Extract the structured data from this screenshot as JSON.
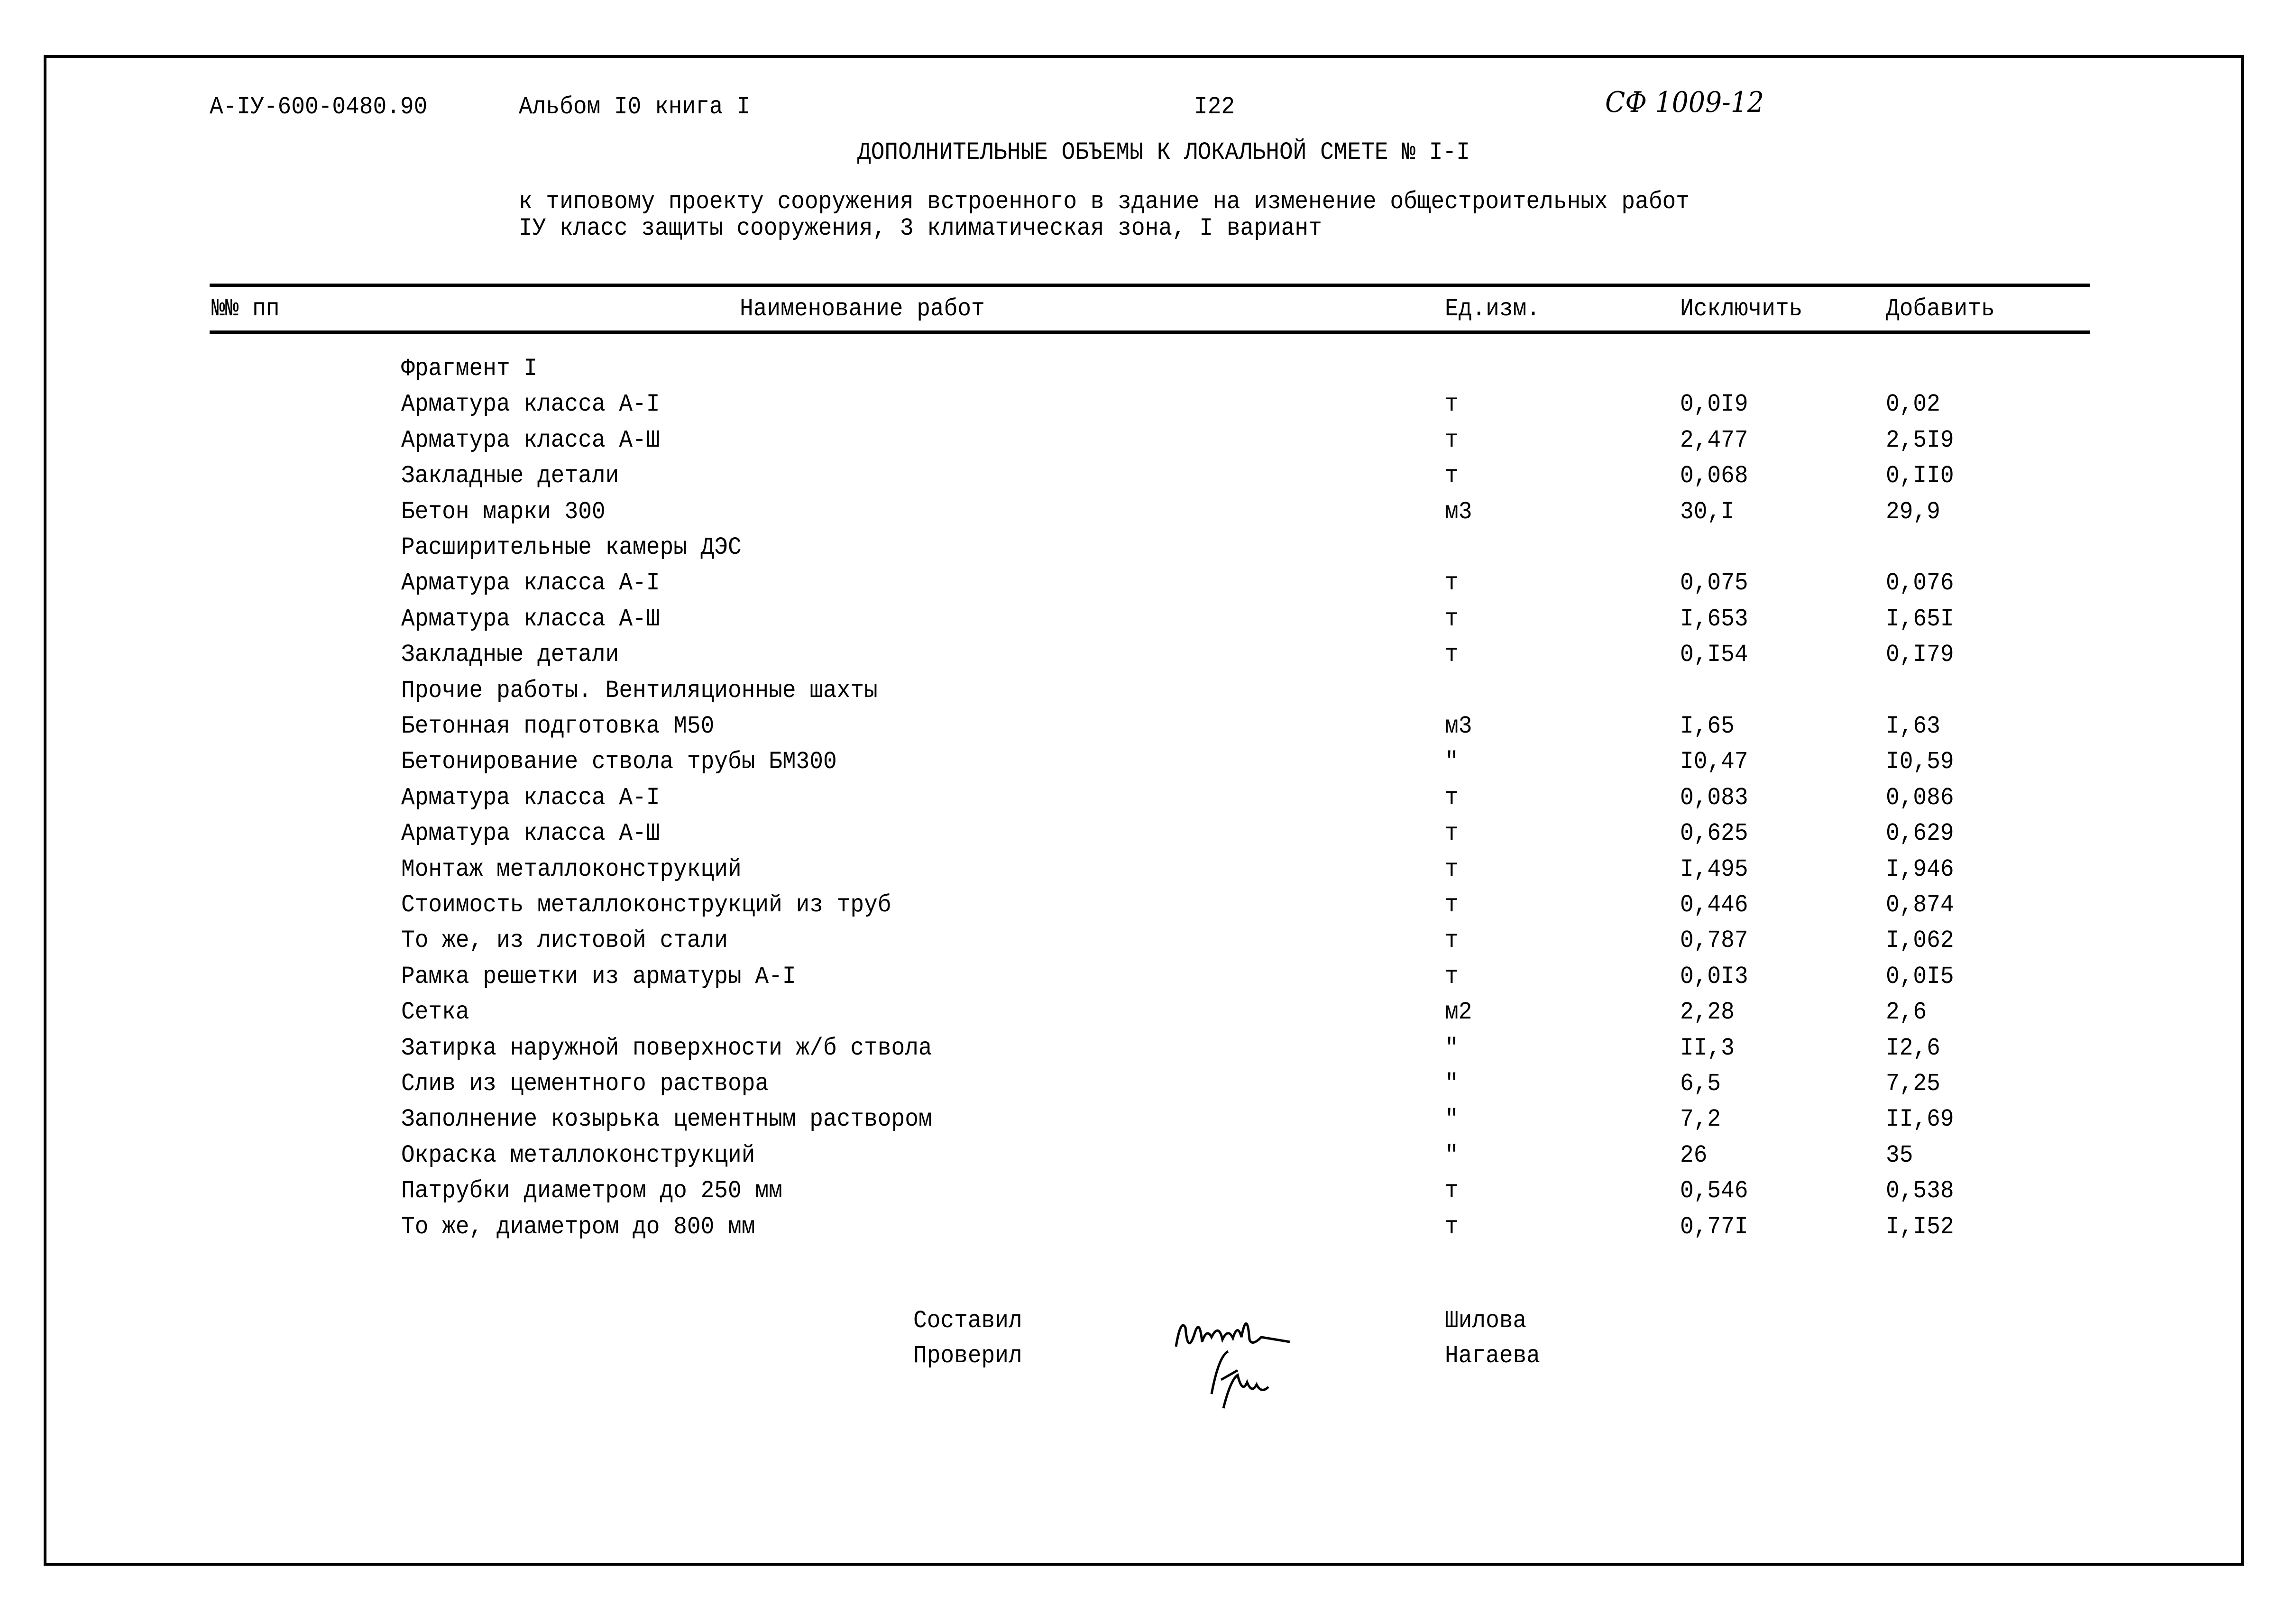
{
  "header": {
    "doc_code": "А-IУ-600-0480.90",
    "album": "Альбом I0 книга I",
    "page_number": "I22",
    "handwritten_ref": "СФ 1009-12"
  },
  "title": "ДОПОЛНИТЕЛЬНЫЕ ОБЪЕМЫ К ЛОКАЛЬНОЙ СМЕТЕ № I-I",
  "subtitle": [
    "к типовому проекту сооружения встроенного в здание на изменение общестроительных работ",
    "IУ класс защиты сооружения, 3 климатическая зона, I вариант"
  ],
  "table": {
    "columns": {
      "number": "№№ пп",
      "name": "Наименование работ",
      "unit": "Ед.изм.",
      "exclude": "Исключить",
      "add": "Добавить"
    },
    "rows": [
      {
        "name": "Фрагмент I",
        "unit": "",
        "exclude": "",
        "add": ""
      },
      {
        "name": "Арматура класса А-I",
        "unit": "т",
        "exclude": "0,0I9",
        "add": "0,02"
      },
      {
        "name": "Арматура класса А-Ш",
        "unit": "т",
        "exclude": "2,477",
        "add": "2,5I9"
      },
      {
        "name": "Закладные детали",
        "unit": "т",
        "exclude": "0,068",
        "add": "0,II0"
      },
      {
        "name": "Бетон марки 300",
        "unit": "м3",
        "exclude": "30,I",
        "add": "29,9"
      },
      {
        "name": "Расширительные камеры ДЭС",
        "unit": "",
        "exclude": "",
        "add": ""
      },
      {
        "name": "Арматура класса А-I",
        "unit": "т",
        "exclude": "0,075",
        "add": "0,076"
      },
      {
        "name": "Арматура класса А-Ш",
        "unit": "т",
        "exclude": "I,653",
        "add": "I,65I"
      },
      {
        "name": "Закладные детали",
        "unit": "т",
        "exclude": "0,I54",
        "add": "0,I79"
      },
      {
        "name": "Прочие работы. Вентиляционные шахты",
        "unit": "",
        "exclude": "",
        "add": ""
      },
      {
        "name": "Бетонная подготовка М50",
        "unit": "м3",
        "exclude": "I,65",
        "add": "I,63"
      },
      {
        "name": "Бетонирование ствола трубы БМ300",
        "unit": "\"",
        "exclude": "I0,47",
        "add": "I0,59"
      },
      {
        "name": "Арматура класса А-I",
        "unit": "т",
        "exclude": "0,083",
        "add": "0,086"
      },
      {
        "name": "Арматура класса А-Ш",
        "unit": "т",
        "exclude": "0,625",
        "add": "0,629"
      },
      {
        "name": "Монтаж металлоконструкций",
        "unit": "т",
        "exclude": "I,495",
        "add": "I,946"
      },
      {
        "name": "Стоимость металлоконструкций из труб",
        "unit": "т",
        "exclude": "0,446",
        "add": "0,874"
      },
      {
        "name": "То же, из листовой стали",
        "unit": "т",
        "exclude": "0,787",
        "add": "I,062"
      },
      {
        "name": "Рамка решетки из арматуры А-I",
        "unit": "т",
        "exclude": "0,0I3",
        "add": "0,0I5"
      },
      {
        "name": "Сетка",
        "unit": "м2",
        "exclude": "2,28",
        "add": "2,6"
      },
      {
        "name": "Затирка наружной поверхности ж/б ствола",
        "unit": "\"",
        "exclude": "II,3",
        "add": "I2,6"
      },
      {
        "name": "Слив из цементного раствора",
        "unit": "\"",
        "exclude": "6,5",
        "add": "7,25"
      },
      {
        "name": "Заполнение козырька цементным раствором",
        "unit": "\"",
        "exclude": "7,2",
        "add": "II,69"
      },
      {
        "name": "Окраска металлоконструкций",
        "unit": "\"",
        "exclude": "26",
        "add": "35"
      },
      {
        "name": "Патрубки диаметром до 250 мм",
        "unit": "т",
        "exclude": "0,546",
        "add": "0,538"
      },
      {
        "name": "То же, диаметром до 800 мм",
        "unit": "т",
        "exclude": "0,77I",
        "add": "I,I52"
      }
    ]
  },
  "signatures": {
    "compiled_label": "Составил",
    "compiled_name": "Шилова",
    "compiled_signature": "Шилова",
    "checked_label": "Проверил",
    "checked_name": "Нагаева",
    "checked_signature": "Нага"
  }
}
